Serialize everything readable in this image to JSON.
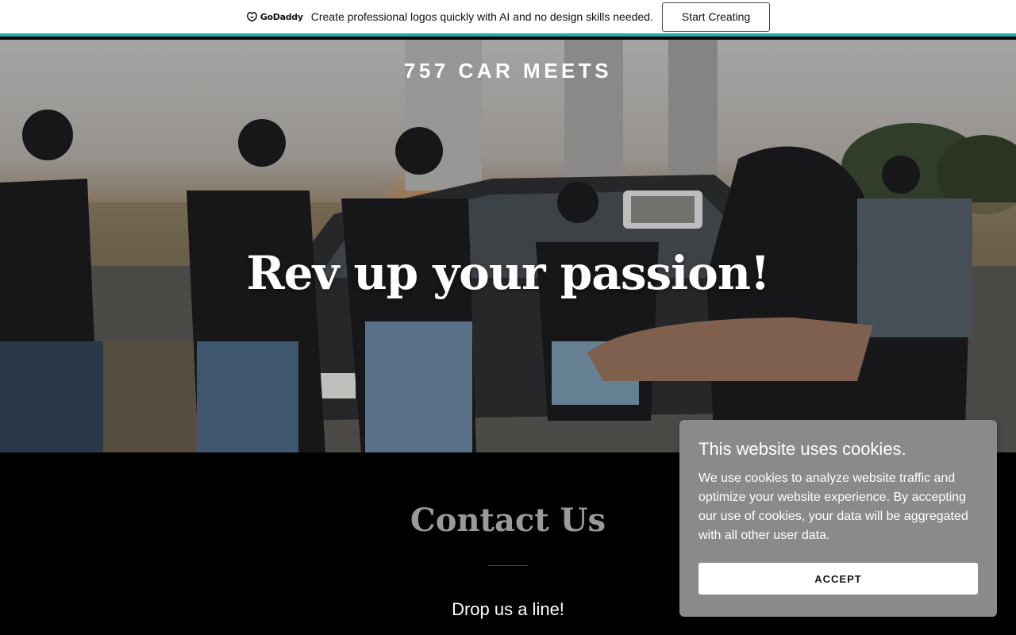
{
  "promo": {
    "brand": "GoDaddy",
    "text": "Create professional logos quickly with AI and no design skills needed.",
    "button_label": "Start Creating",
    "accent_color": "#1bb1b1"
  },
  "hero": {
    "site_title": "757 CAR MEETS",
    "headline": "Rev up your passion!"
  },
  "contact": {
    "title": "Contact Us",
    "subtitle": "Drop us a line!"
  },
  "cookie_banner": {
    "title": "This website uses cookies.",
    "body": "We use cookies to analyze website traffic and optimize your website experience. By accepting our use of cookies, your data will be aggregated with all other user data.",
    "accept_label": "ACCEPT"
  }
}
